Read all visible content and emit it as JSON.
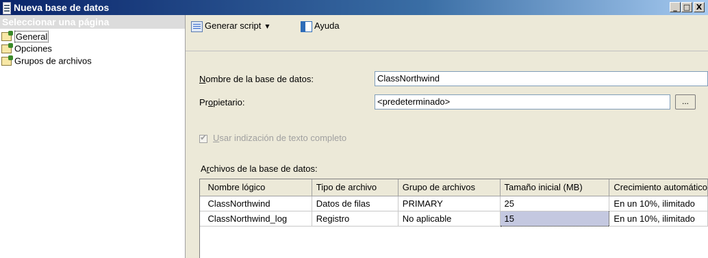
{
  "window": {
    "title": "Nueva base de datos",
    "caption_buttons": {
      "minimize": "_",
      "maximize": "□",
      "close": "X"
    }
  },
  "left_pane": {
    "header": "Seleccionar una página",
    "items": [
      {
        "label": "General",
        "selected": true,
        "icon": "page-icon"
      },
      {
        "label": "Opciones",
        "selected": false,
        "icon": "page-icon"
      },
      {
        "label": "Grupos de archivos",
        "selected": false,
        "icon": "page-icon"
      }
    ]
  },
  "toolbar": {
    "script_label": "Generar script",
    "help_label": "Ayuda"
  },
  "form": {
    "db_name_label_pre": "",
    "db_name_label_key": "N",
    "db_name_label_post": "ombre de la base de datos:",
    "db_name_value": "ClassNorthwind",
    "owner_label_pre": "Pr",
    "owner_label_key": "o",
    "owner_label_post": "pietario:",
    "owner_value": "<predeterminado>",
    "browse_label": "...",
    "fulltext_label_key": "U",
    "fulltext_label_post": "sar indización de texto completo",
    "fulltext_checked": true,
    "files_label_pre": "A",
    "files_label_key": "r",
    "files_label_post": "chivos de la base de datos:"
  },
  "grid": {
    "columns": [
      "Nombre lógico",
      "Tipo de archivo",
      "Grupo de archivos",
      "Tamaño inicial (MB)",
      "Crecimiento automático"
    ],
    "rows": [
      [
        "ClassNorthwind",
        "Datos de filas",
        "PRIMARY",
        "25",
        "En un 10%, ilimitado"
      ],
      [
        "ClassNorthwind_log",
        "Registro",
        "No aplicable",
        "15",
        "En un 10%, ilimitado"
      ]
    ]
  },
  "colors": {
    "title_gradient_start": "#0a246a",
    "selected_cell": "#c4c8e0",
    "window_bg": "#ece9d8"
  }
}
